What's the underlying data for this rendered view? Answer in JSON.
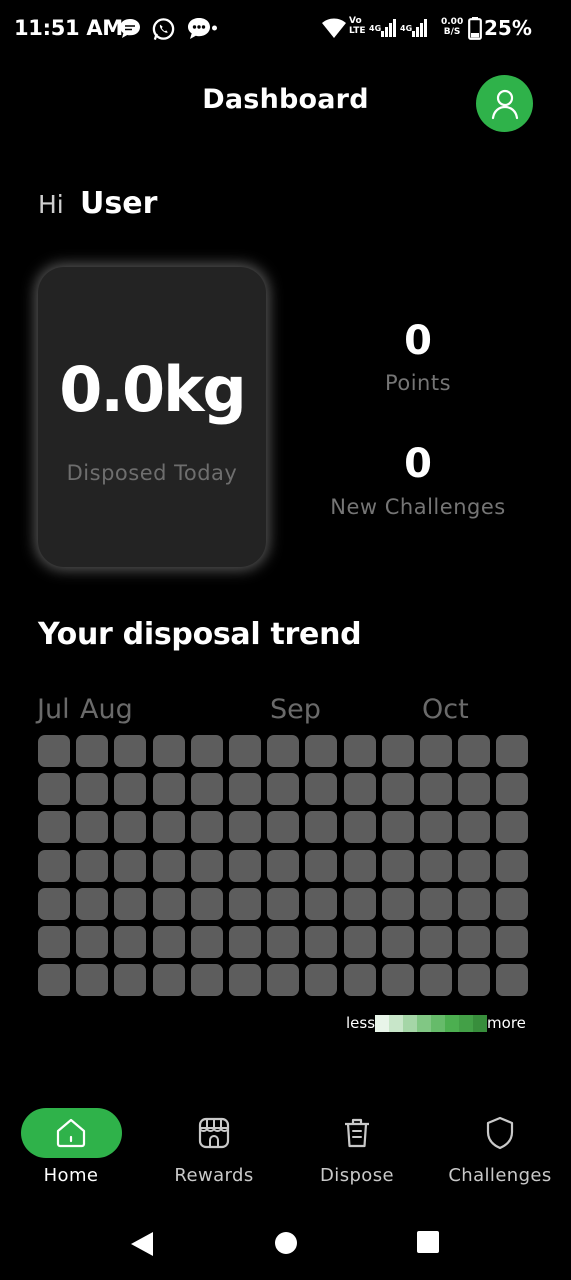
{
  "status_bar": {
    "time": "11:51 AM",
    "net_top": "Vo",
    "net_bottom": "LTE",
    "net_speed_top": "0.00",
    "net_speed_bottom": "B/S",
    "battery": "25%"
  },
  "header": {
    "title": "Dashboard"
  },
  "greeting": {
    "prefix": "Hi",
    "name": "User"
  },
  "disposed": {
    "value": "0.0kg",
    "label": "Disposed Today"
  },
  "stats": {
    "points_value": "0",
    "points_label": "Points",
    "challenges_value": "0",
    "challenges_label": "New Challenges"
  },
  "trend": {
    "title": "Your disposal trend",
    "months": [
      "Jul",
      "Aug",
      "Sep",
      "Oct"
    ],
    "rows": 7,
    "cols": 13,
    "cell_color": "#5d5d5d",
    "legend_less": "less",
    "legend_more": "more",
    "legend_colors": [
      "#e8f5e9",
      "#c8e6c9",
      "#a5d6a7",
      "#81c784",
      "#66bb6a",
      "#4caf50",
      "#43a047",
      "#388e3c"
    ]
  },
  "bottom_nav": [
    {
      "label": "Home",
      "icon": "home-icon",
      "active": true
    },
    {
      "label": "Rewards",
      "icon": "store-icon",
      "active": false
    },
    {
      "label": "Dispose",
      "icon": "trash-icon",
      "active": false
    },
    {
      "label": "Challenges",
      "icon": "shield-icon",
      "active": false
    }
  ],
  "colors": {
    "accent": "#2fb24a",
    "background": "#000000",
    "card": "#232323"
  }
}
